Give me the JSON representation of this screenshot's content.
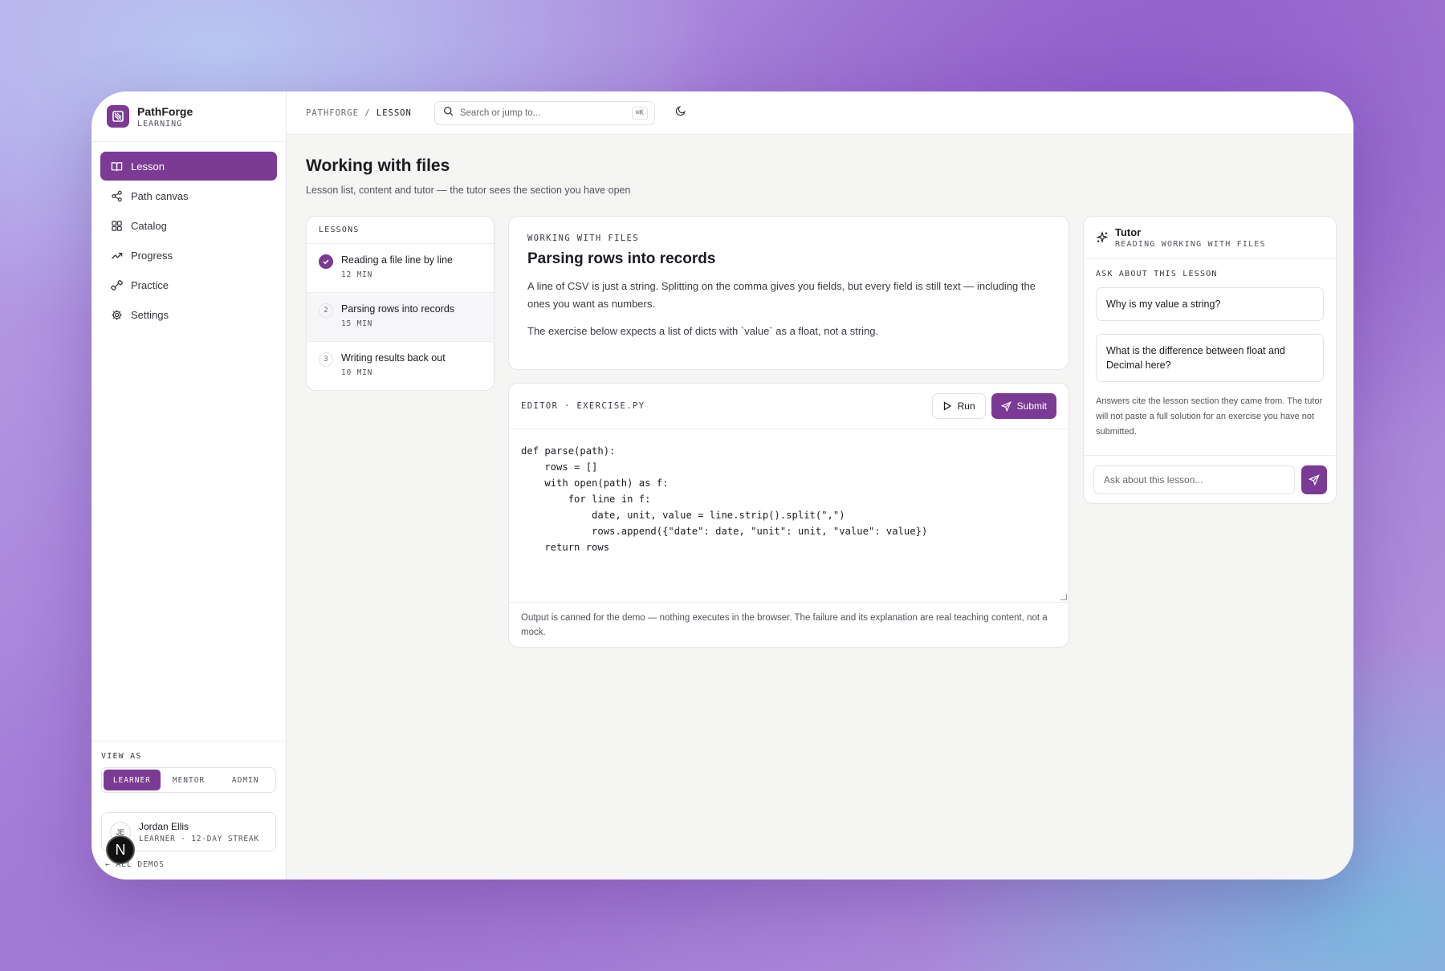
{
  "brand": {
    "name": "PathForge",
    "sub": "LEARNING"
  },
  "sidebar": {
    "items": [
      {
        "label": "Lesson",
        "icon": "book-icon",
        "active": true
      },
      {
        "label": "Path canvas",
        "icon": "share-nodes-icon"
      },
      {
        "label": "Catalog",
        "icon": "grid-icon"
      },
      {
        "label": "Progress",
        "icon": "trend-icon"
      },
      {
        "label": "Practice",
        "icon": "dumbbell-icon"
      },
      {
        "label": "Settings",
        "icon": "gear-icon"
      }
    ],
    "view_as": {
      "label": "VIEW AS",
      "options": [
        "LEARNER",
        "MENTOR",
        "ADMIN"
      ],
      "selected": "LEARNER"
    },
    "user": {
      "initials": "JE",
      "name": "Jordan Ellis",
      "sub": "LEARNER · 12-DAY STREAK"
    },
    "all_demos": "ALL DEMOS"
  },
  "topbar": {
    "breadcrumb_root": "PATHFORGE",
    "breadcrumb_sep": "/",
    "breadcrumb_current": "LESSON",
    "search_placeholder": "Search or jump to...",
    "search_shortcut": "⌘K"
  },
  "page": {
    "title": "Working with files",
    "subtitle": "Lesson list, content and tutor — the tutor sees the section you have open"
  },
  "lessons": {
    "header": "LESSONS",
    "items": [
      {
        "mark": "✓",
        "title": "Reading a file line by line",
        "duration": "12 MIN",
        "done": true
      },
      {
        "mark": "2",
        "title": "Parsing rows into records",
        "duration": "15 MIN",
        "active": true
      },
      {
        "mark": "3",
        "title": "Writing results back out",
        "duration": "10 MIN"
      }
    ]
  },
  "content": {
    "kicker": "WORKING WITH FILES",
    "title": "Parsing rows into records",
    "paragraph1": "A line of CSV is just a string. Splitting on the comma gives you fields, but every field is still text — including the ones you want as numbers.",
    "paragraph2": "The exercise below expects a list of dicts with `value` as a float, not a string."
  },
  "editor": {
    "label": "EDITOR · EXERCISE.PY",
    "run_label": "Run",
    "submit_label": "Submit",
    "code": "def parse(path):\n    rows = []\n    with open(path) as f:\n        for line in f:\n            date, unit, value = line.strip().split(\",\")\n            rows.append({\"date\": date, \"unit\": unit, \"value\": value})\n    return rows",
    "footer": "Output is canned for the demo — nothing executes in the browser. The failure and its explanation are real teaching content, not a mock."
  },
  "tutor": {
    "title": "Tutor",
    "subtitle": "READING WORKING WITH FILES",
    "ask_label": "ASK ABOUT THIS LESSON",
    "suggestions": [
      "Why is my value a string?",
      "What is the difference between float and Decimal here?"
    ],
    "note": "Answers cite the lesson section they came from. The tutor will not paste a full solution for an exercise you have not submitted.",
    "input_placeholder": "Ask about this lesson..."
  },
  "colors": {
    "accent": "#7b3a93",
    "surface": "#ffffff",
    "canvas": "#f5f5f3"
  }
}
